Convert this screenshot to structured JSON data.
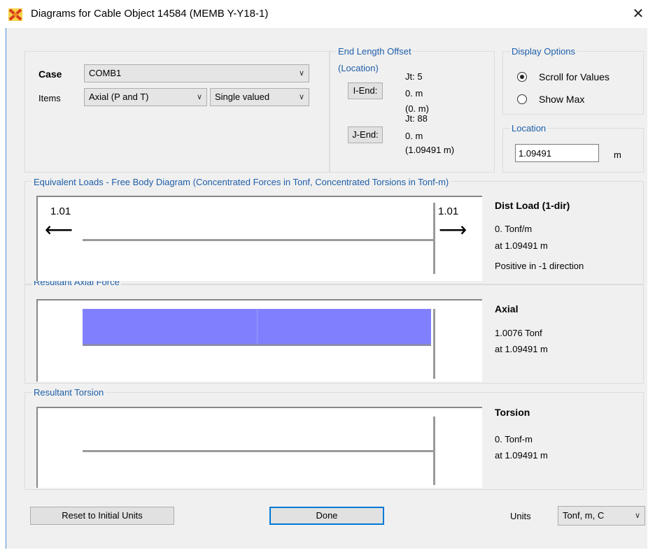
{
  "window": {
    "title": "Diagrams for Cable Object 14584  (MEMB Y-Y18-1)",
    "close_glyph": "✕",
    "app_icon": "sap2000-icon"
  },
  "case_section": {
    "case_label": "Case",
    "case_value": "COMB1",
    "items_label": "Items",
    "items_value": "Axial (P and T)",
    "valued_value": "Single valued"
  },
  "end_length_offset": {
    "group_label": "End Length Offset",
    "location_label": "(Location)",
    "i_end_button": "I-End:",
    "j_end_button": "J-End:",
    "i_jt": "Jt:  5",
    "i_offset": "0. m",
    "i_location": "(0. m)",
    "j_jt": "Jt:  88",
    "j_offset": "0. m",
    "j_location": "(1.09491 m)"
  },
  "display_options": {
    "group_label": "Display Options",
    "scroll_label": "Scroll for Values",
    "show_max_label": "Show Max",
    "selected": "Scroll for Values"
  },
  "location": {
    "group_label": "Location",
    "value": "1.09491",
    "unit": "m"
  },
  "equivalent_loads": {
    "group_label": "Equivalent Loads - Free Body Diagram  (Concentrated Forces in Tonf, Concentrated Torsions in Tonf-m)",
    "left_value": "1.01",
    "right_value": "1.01",
    "left_arrow": "⟵",
    "right_arrow": "⟶",
    "info_title": "Dist Load (1-dir)",
    "info_value": "0. Tonf/m",
    "info_at": "at 1.09491 m",
    "info_note": "Positive in -1 direction"
  },
  "axial_force": {
    "group_label": "Resultant Axial Force",
    "info_title": "Axial",
    "info_value": "1.0076 Tonf",
    "info_at": "at 1.09491 m",
    "fill_color": "#8080ff"
  },
  "torsion": {
    "group_label": "Resultant Torsion",
    "info_title": "Torsion",
    "info_value": "0. Tonf-m",
    "info_at": "at 1.09491 m"
  },
  "footer": {
    "reset_button": "Reset to Initial Units",
    "done_button": "Done",
    "units_label": "Units",
    "units_value": "Tonf, m, C"
  }
}
